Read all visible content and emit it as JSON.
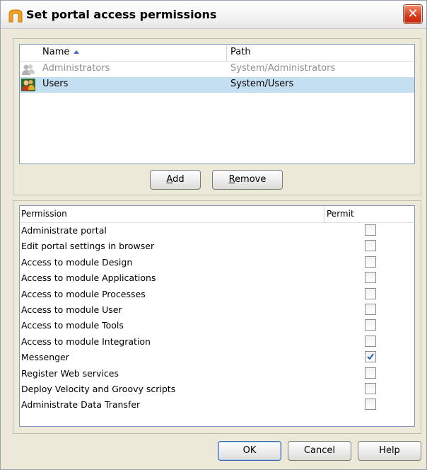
{
  "window": {
    "title": "Set portal access permissions",
    "close_glyph": "✕"
  },
  "groups": {
    "columns": {
      "name": "Name",
      "path": "Path"
    },
    "sort": "ascending",
    "rows": [
      {
        "name": "Administrators",
        "path": "System/Administrators",
        "icon": "group-icon",
        "state": "disabled"
      },
      {
        "name": "Users",
        "path": "System/Users",
        "icon": "users-icon",
        "state": "selected"
      }
    ]
  },
  "group_buttons": {
    "add_mnemonic": "A",
    "add_rest": "dd",
    "remove_mnemonic": "R",
    "remove_rest": "emove"
  },
  "permissions": {
    "columns": {
      "permission": "Permission",
      "permit": "Permit"
    },
    "items": [
      {
        "label": "Administrate portal",
        "checked": false
      },
      {
        "label": "Edit portal settings in browser",
        "checked": false
      },
      {
        "label": "Access to module Design",
        "checked": false
      },
      {
        "label": "Access to module Applications",
        "checked": false
      },
      {
        "label": "Access to module Processes",
        "checked": false
      },
      {
        "label": "Access to module User",
        "checked": false
      },
      {
        "label": "Access to module Tools",
        "checked": false
      },
      {
        "label": "Access to module Integration",
        "checked": false
      },
      {
        "label": "Messenger",
        "checked": true
      },
      {
        "label": "Register Web services",
        "checked": false
      },
      {
        "label": "Deploy Velocity and Groovy scripts",
        "checked": false
      },
      {
        "label": "Administrate Data Transfer",
        "checked": false
      }
    ]
  },
  "footer": {
    "ok": "OK",
    "cancel": "Cancel",
    "help": "Help"
  },
  "colors": {
    "selection": "#c5dff2",
    "checkmark": "#2c58b7",
    "close_button": "#d4391c"
  }
}
